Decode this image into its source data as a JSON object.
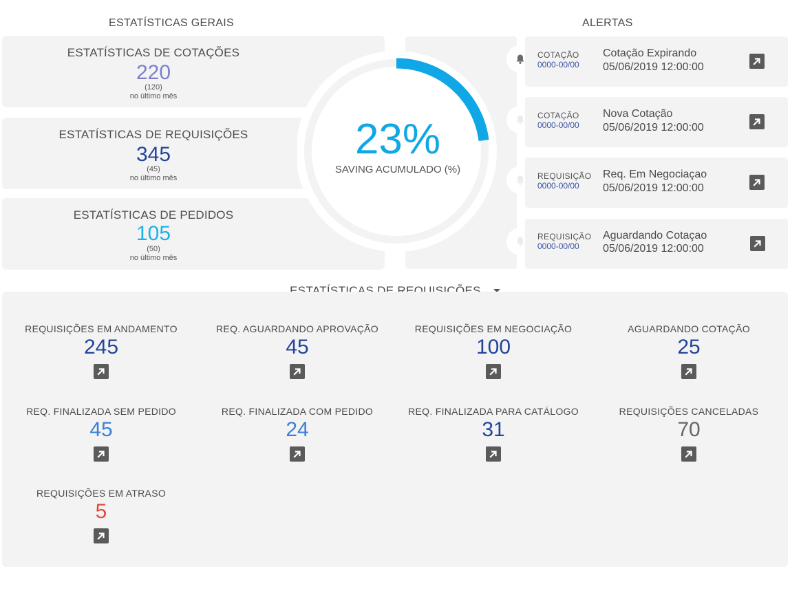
{
  "sections": {
    "general_title": "ESTATÍSTICAS GERAIS",
    "alerts_title": "ALERTAS"
  },
  "stats": [
    {
      "title": "ESTATÍSTICAS DE COTAÇÕES",
      "value": "220",
      "previous": "(120)",
      "period": "no último mês",
      "color": "#7b80c8"
    },
    {
      "title": "ESTATÍSTICAS DE REQUISIÇÕES",
      "value": "345",
      "previous": "(45)",
      "period": "no último mês",
      "color": "#24449a"
    },
    {
      "title": "ESTATÍSTICAS DE PEDIDOS",
      "value": "105",
      "previous": "(50)",
      "period": "no último mês",
      "color": "#19b2ec"
    }
  ],
  "gauge": {
    "percent_text": "23%",
    "percent_value": 23,
    "label": "SAVING ACUMULADO (%)",
    "color": "#0fa7e6"
  },
  "alerts": [
    {
      "type": "COTAÇÃO",
      "code": "0000-00/00",
      "title": "Cotação Expirando",
      "date": "05/06/2019 12:00:00",
      "icon": "bell-icon",
      "active": true
    },
    {
      "type": "COTAÇÃO",
      "code": "0000-00/00",
      "title": "Nova Cotação",
      "date": "05/06/2019 12:00:00",
      "icon": "bell-icon",
      "active": false
    },
    {
      "type": "REQUISIÇÃO",
      "code": "0000-00/00",
      "title": "Req. Em Negociaçao",
      "date": "05/06/2019 12:00:00",
      "icon": "bell-icon",
      "active": false
    },
    {
      "type": "REQUISIÇÃO",
      "code": "0000-00/00",
      "title": "Aguardando Cotaçao",
      "date": "05/06/2019 12:00:00",
      "icon": "bell-icon",
      "active": false
    }
  ],
  "selector": {
    "selected": "ESTATÍSTICAS DE REQUISIÇÕES"
  },
  "metrics": [
    {
      "label": "REQUISIÇÕES EM ANDAMENTO",
      "value": "245",
      "color": "#24449a"
    },
    {
      "label": "REQ. AGUARDANDO APROVAÇÃO",
      "value": "45",
      "color": "#24449a"
    },
    {
      "label": "REQUISIÇÕES EM NEGOCIAÇÃO",
      "value": "100",
      "color": "#24449a"
    },
    {
      "label": "AGUARDANDO COTAÇÃO",
      "value": "25",
      "color": "#24449a"
    },
    {
      "label": "REQ. FINALIZADA SEM PEDIDO",
      "value": "45",
      "color": "#3b7fd6"
    },
    {
      "label": "REQ. FINALIZADA COM PEDIDO",
      "value": "24",
      "color": "#3b7fd6"
    },
    {
      "label": "REQ. FINALIZADA PARA CATÁLOGO",
      "value": "31",
      "color": "#24449a"
    },
    {
      "label": "REQUISIÇÕES CANCELADAS",
      "value": "70",
      "color": "#666666"
    },
    {
      "label": "REQUISIÇÕES EM ATRASO",
      "value": "5",
      "color": "#e2493a"
    }
  ]
}
